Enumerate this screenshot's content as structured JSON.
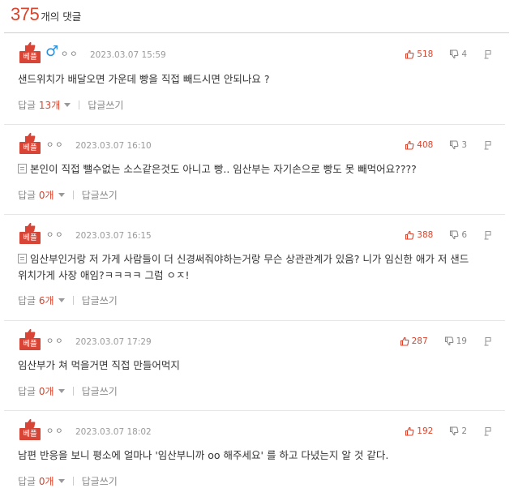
{
  "header": {
    "count": "375",
    "suffix": "개의 댓글"
  },
  "badge_label": "베플",
  "reply_prefix": "답글",
  "write_reply": "답글쓰기",
  "gender_symbol": "♂",
  "colors": {
    "accent": "#d9442c",
    "badge": "#d84536",
    "gender": "#2f8fd8"
  },
  "icons": {
    "like": "thumbs-up-icon",
    "dislike": "thumbs-down-icon",
    "report": "flag-icon",
    "document": "document-icon"
  },
  "comments": [
    {
      "nickname": "ㅇㅇ",
      "date": "2023.03.07 15:59",
      "likes": "518",
      "dislikes": "4",
      "line1": "샌드위치가 배달오면 가운데 빵을 직접 빼드시면 안되나요 ?",
      "line2": "",
      "reply_count": "13개"
    },
    {
      "nickname": "ㅇㅇ",
      "date": "2023.03.07 16:10",
      "likes": "408",
      "dislikes": "3",
      "line1": "본인이 직접 뺄수없는 소스같은것도 아니고 빵.. 임산부는 자기손으로 빵도 못 빼먹어요????",
      "line2": "",
      "reply_count": "0개"
    },
    {
      "nickname": "ㅇㅇ",
      "date": "2023.03.07 16:15",
      "likes": "388",
      "dislikes": "6",
      "line1": "임산부인거랑 저 가게 사람들이 더 신경써줘야하는거랑 무슨 상관관계가 있음? 니가 임신한 애가 저 샌드",
      "line2": "위치가게 사장 애임?ㅋㅋㅋㅋ 그럼 ㅇㅈ!",
      "reply_count": "6개"
    },
    {
      "nickname": "ㅇㅇ",
      "date": "2023.03.07 17:29",
      "likes": "287",
      "dislikes": "19",
      "line1": "임산부가 쳐 먹을거면 직접 만들어먹지",
      "line2": "",
      "reply_count": "0개"
    },
    {
      "nickname": "ㅇㅇ",
      "date": "2023.03.07 18:02",
      "likes": "192",
      "dislikes": "2",
      "line1": "남편 반응을 보니 평소에 얼마나 '임산부니까 oo 해주세요' 를 하고 다녔는지 알 것 같다.",
      "line2": "",
      "reply_count": "0개"
    }
  ]
}
